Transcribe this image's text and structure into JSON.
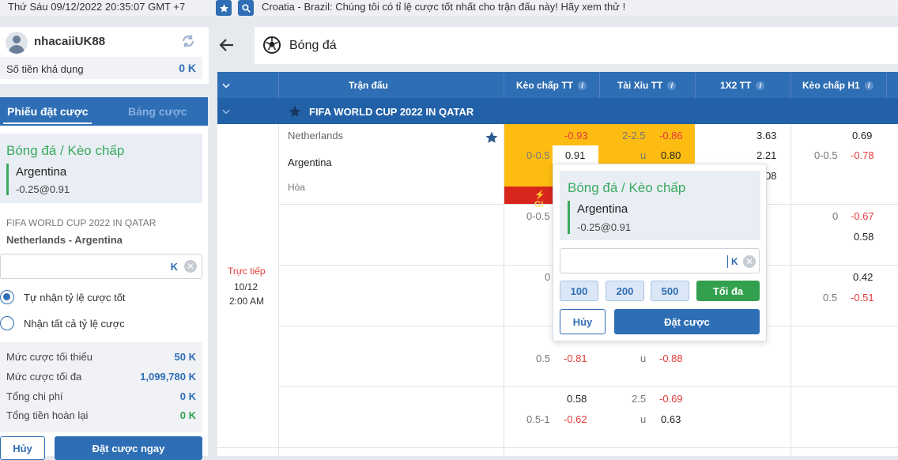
{
  "topbar": {
    "datetime": "Thứ Sáu 09/12/2022 20:35:07 GMT +7",
    "marquee": "Croatia - Brazil: Chúng tôi có tỉ lệ cược tốt nhất cho trận đấu này! Hãy xem thử !"
  },
  "user": {
    "name": "nhacaiiUK88",
    "balance_label": "Số tiền khả dụng",
    "balance": "0 K"
  },
  "slip": {
    "tab_active": "Phiếu đặt cược",
    "tab_inactive": "Bảng cược",
    "bet_title": "Bóng đá / Kèo chấp",
    "bet_team": "Argentina",
    "bet_odds": "-0.25@0.91",
    "league": "FIFA WORLD CUP 2022 IN QATAR",
    "match": "Netherlands - Argentina",
    "amount_unit": "K",
    "option1": "Tự nhận tỷ lệ cược tốt",
    "option2": "Nhận tất cả tỷ lệ cược",
    "limits": [
      {
        "label": "Mức cược tối thiểu",
        "value": "50 K",
        "color": "#2e6eb5"
      },
      {
        "label": "Mức cược tối đa",
        "value": "1,099,780 K",
        "color": "#2e6eb5"
      },
      {
        "label": "Tổng chi phí",
        "value": "0 K",
        "color": "#2e6eb5"
      },
      {
        "label": "Tổng tiền hoàn lại",
        "value": "0 K",
        "color": "#33a04d"
      }
    ],
    "cancel": "Hủy",
    "place": "Đặt cược ngay"
  },
  "header": {
    "sport": "Bóng đá"
  },
  "table": {
    "columns": [
      "Trận đấu",
      "Kèo chấp TT",
      "Tài Xỉu TT",
      "1X2 TT",
      "Kèo chấp H1"
    ],
    "league": "FIFA WORLD CUP 2022 IN QATAR",
    "time": {
      "live": "Trực tiếp",
      "date": "10/12",
      "hour": "2:00 AM"
    },
    "team_home": "Netherlands",
    "team_away": "Argentina",
    "draw": "Hòa",
    "live_badge": "Gi",
    "cells": {
      "r1_hdp_home": "-0.93",
      "r1_hdp_line": "0-0.5",
      "r1_hdp_away": "0.91",
      "r1_ou_line": "2-2.5",
      "r1_ou_over": "-0.86",
      "r1_ou_u": "u",
      "r1_ou_under": "0.80",
      "r1_1x2_1": "3.63",
      "r1_1x2_2": "2.21",
      "r1_1x2_x": "08",
      "r1_h1_home": "0.69",
      "r1_h1_line": "0-0.5",
      "r1_h1_away": "-0.78",
      "r2_hdp_line": "0-0.5",
      "r2_h1_line": "0",
      "r2_h1_home": "-0.67",
      "r2_h1_away": "0.58",
      "r3_hdp_line": "0",
      "r3_h1_home": "0.42",
      "r3_h1_line": "0.5",
      "r3_h1_away": "-0.51",
      "r4_hdp_line": "0.5",
      "r4_hdp_away": "-0.81",
      "r4_ou_u": "u",
      "r4_ou_under": "-0.88",
      "r5_hdp_home": "0.58",
      "r5_hdp_line": "0.5-1",
      "r5_hdp_away": "-0.62",
      "r5_ou_line": "2.5",
      "r5_ou_over": "-0.69",
      "r5_ou_u": "u",
      "r5_ou_under": "0.63"
    }
  },
  "popup": {
    "title": "Bóng đá / Kèo chấp",
    "team": "Argentina",
    "odds": "-0.25@0.91",
    "unit": "K",
    "chips": [
      "100",
      "200",
      "500"
    ],
    "max": "Tối đa",
    "cancel": "Hủy",
    "place": "Đặt cược"
  }
}
